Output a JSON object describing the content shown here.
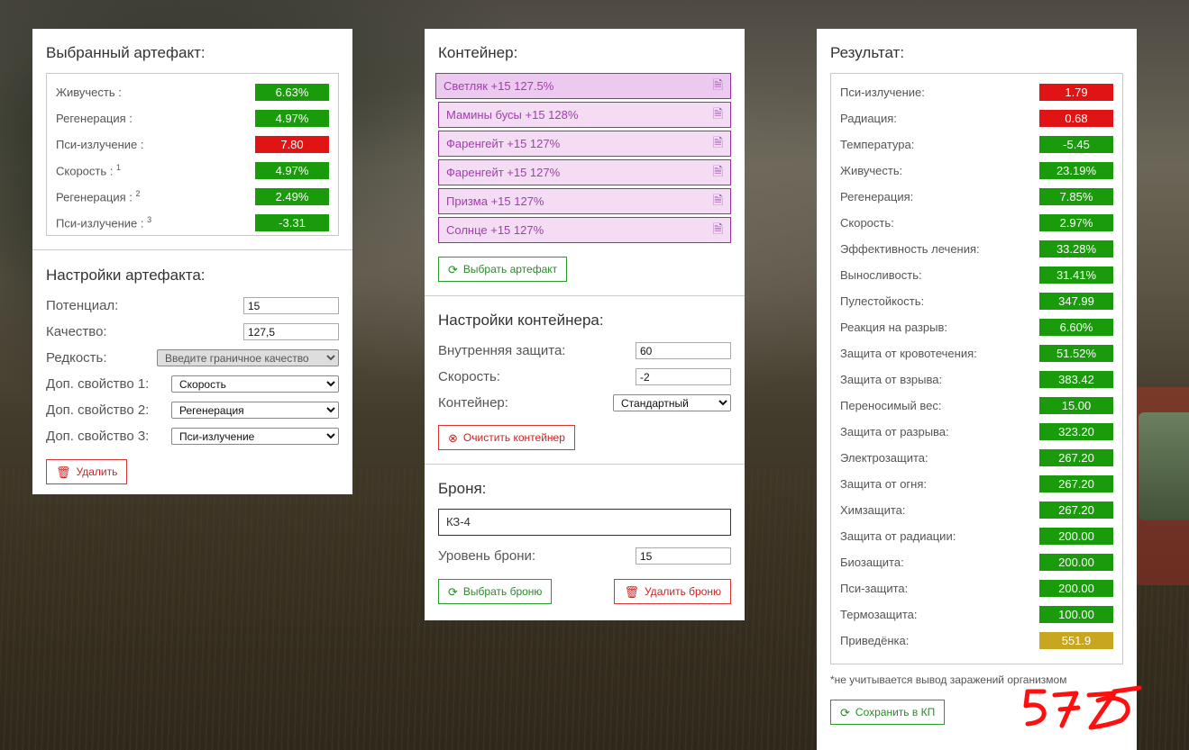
{
  "colors": {
    "green": "#1a9b0c",
    "red": "#e01414",
    "yellow": "#c8a620",
    "purple": "#a43caf"
  },
  "artifact": {
    "title": "Выбранный артефакт:",
    "stats": [
      {
        "label": "Живучесть :",
        "sup": "",
        "value": "6.63%",
        "color": "green"
      },
      {
        "label": "Регенерация :",
        "sup": "",
        "value": "4.97%",
        "color": "green"
      },
      {
        "label": "Пси-излучение :",
        "sup": "",
        "value": "7.80",
        "color": "red"
      },
      {
        "label": "Скорость :",
        "sup": "1",
        "value": "4.97%",
        "color": "green"
      },
      {
        "label": "Регенерация :",
        "sup": "2",
        "value": "2.49%",
        "color": "green"
      },
      {
        "label": "Пси-излучение :",
        "sup": "3",
        "value": "-3.31",
        "color": "green"
      }
    ]
  },
  "artifact_settings": {
    "title": "Настройки артефакта:",
    "potential_label": "Потенциал:",
    "potential_value": "15",
    "quality_label": "Качество:",
    "quality_value": "127,5",
    "rarity_label": "Редкость:",
    "rarity_value": "Введите граничное качество",
    "extra1_label": "Доп. свойство 1:",
    "extra1_value": "Скорость",
    "extra2_label": "Доп. свойство 2:",
    "extra2_value": "Регенерация",
    "extra3_label": "Доп. свойство 3:",
    "extra3_value": "Пси-излучение",
    "delete_label": "Удалить"
  },
  "container": {
    "title": "Контейнер:",
    "items": [
      {
        "label": "Светляк +15 127.5%",
        "active": true
      },
      {
        "label": "Мамины бусы +15 128%",
        "active": false
      },
      {
        "label": "Фаренгейт +15 127%",
        "active": false
      },
      {
        "label": "Фаренгейт +15 127%",
        "active": false
      },
      {
        "label": "Призма +15 127%",
        "active": false
      },
      {
        "label": "Солнце +15 127%",
        "active": false
      }
    ],
    "choose_label": "Выбрать артефакт"
  },
  "container_settings": {
    "title": "Настройки контейнера:",
    "protection_label": "Внутренняя защита:",
    "protection_value": "60",
    "speed_label": "Скорость:",
    "speed_value": "-2",
    "type_label": "Контейнер:",
    "type_value": "Стандартный",
    "clear_label": "Очистить контейнер"
  },
  "armor": {
    "title": "Броня:",
    "name": "КЗ-4",
    "level_label": "Уровень брони:",
    "level_value": "15",
    "choose_label": "Выбрать броню",
    "delete_label": "Удалить броню"
  },
  "result": {
    "title": "Результат:",
    "stats": [
      {
        "label": "Пси-излучение:",
        "value": "1.79",
        "color": "red"
      },
      {
        "label": "Радиация:",
        "value": "0.68",
        "color": "red"
      },
      {
        "label": "Температура:",
        "value": "-5.45",
        "color": "green"
      },
      {
        "label": "Живучесть:",
        "value": "23.19%",
        "color": "green"
      },
      {
        "label": "Регенерация:",
        "value": "7.85%",
        "color": "green"
      },
      {
        "label": "Скорость:",
        "value": "2.97%",
        "color": "green"
      },
      {
        "label": "Эффективность лечения:",
        "value": "33.28%",
        "color": "green"
      },
      {
        "label": "Выносливость:",
        "value": "31.41%",
        "color": "green"
      },
      {
        "label": "Пулестойкость:",
        "value": "347.99",
        "color": "green"
      },
      {
        "label": "Реакция на разрыв:",
        "value": "6.60%",
        "color": "green"
      },
      {
        "label": "Защита от кровотечения:",
        "value": "51.52%",
        "color": "green"
      },
      {
        "label": "Защита от взрыва:",
        "value": "383.42",
        "color": "green"
      },
      {
        "label": "Переносимый вес:",
        "value": "15.00",
        "color": "green"
      },
      {
        "label": "Защита от разрыва:",
        "value": "323.20",
        "color": "green"
      },
      {
        "label": "Электрозащита:",
        "value": "267.20",
        "color": "green"
      },
      {
        "label": "Защита от огня:",
        "value": "267.20",
        "color": "green"
      },
      {
        "label": "Химзащита:",
        "value": "267.20",
        "color": "green"
      },
      {
        "label": "Защита от радиации:",
        "value": "200.00",
        "color": "green"
      },
      {
        "label": "Биозащита:",
        "value": "200.00",
        "color": "green"
      },
      {
        "label": "Пси-защита:",
        "value": "200.00",
        "color": "green"
      },
      {
        "label": "Термозащита:",
        "value": "100.00",
        "color": "green"
      },
      {
        "label": "Приведёнка:",
        "value": "551.9",
        "color": "yellow"
      }
    ],
    "note": "*не учитывается вывод заражений организмом",
    "save_label": "Сохранить в КП"
  },
  "handwritten": "575"
}
